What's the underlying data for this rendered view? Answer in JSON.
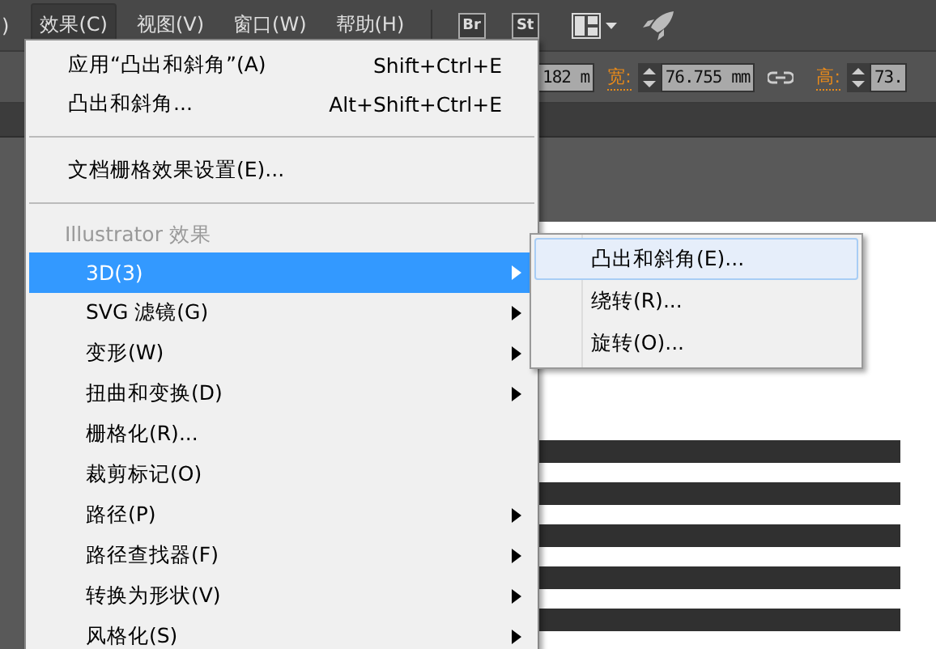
{
  "menubar": {
    "items": [
      {
        "label": ")",
        "selected": false
      },
      {
        "label": "效果(C)",
        "selected": true
      },
      {
        "label": "视图(V)",
        "selected": false
      },
      {
        "label": "窗口(W)",
        "selected": false
      },
      {
        "label": "帮助(H)",
        "selected": false
      }
    ],
    "app_buttons": [
      "Br",
      "St"
    ]
  },
  "control_bar": {
    "x_value": "182 m",
    "width_label": "宽:",
    "width_value": "76.755 mm",
    "height_label": "高:",
    "height_value": "73."
  },
  "menu": {
    "items": [
      {
        "kind": "item",
        "label": "应用“凸出和斜角”(A)",
        "shortcut": "Shift+Ctrl+E",
        "submenu": false,
        "selected": false
      },
      {
        "kind": "item",
        "label": "凸出和斜角...",
        "shortcut": "Alt+Shift+Ctrl+E",
        "submenu": false,
        "selected": false
      },
      {
        "kind": "separator"
      },
      {
        "kind": "item",
        "label": "文档栅格效果设置(E)...",
        "submenu": false,
        "selected": false
      },
      {
        "kind": "separator"
      },
      {
        "kind": "header",
        "label": "Illustrator 效果"
      },
      {
        "kind": "effect",
        "label": "3D(3)",
        "submenu": true,
        "selected": true
      },
      {
        "kind": "effect",
        "label": "SVG 滤镜(G)",
        "submenu": true,
        "selected": false
      },
      {
        "kind": "effect",
        "label": "变形(W)",
        "submenu": true,
        "selected": false
      },
      {
        "kind": "effect",
        "label": "扭曲和变换(D)",
        "submenu": true,
        "selected": false
      },
      {
        "kind": "effect",
        "label": "栅格化(R)...",
        "submenu": false,
        "selected": false
      },
      {
        "kind": "effect",
        "label": "裁剪标记(O)",
        "submenu": false,
        "selected": false
      },
      {
        "kind": "effect",
        "label": "路径(P)",
        "submenu": true,
        "selected": false
      },
      {
        "kind": "effect",
        "label": "路径查找器(F)",
        "submenu": true,
        "selected": false
      },
      {
        "kind": "effect",
        "label": "转换为形状(V)",
        "submenu": true,
        "selected": false
      },
      {
        "kind": "effect",
        "label": "风格化(S)",
        "submenu": true,
        "selected": false
      }
    ]
  },
  "submenu": {
    "items": [
      {
        "label": "凸出和斜角(E)...",
        "selected": true
      },
      {
        "label": "绕转(R)...",
        "selected": false
      },
      {
        "label": "旋转(O)...",
        "selected": false
      }
    ]
  }
}
